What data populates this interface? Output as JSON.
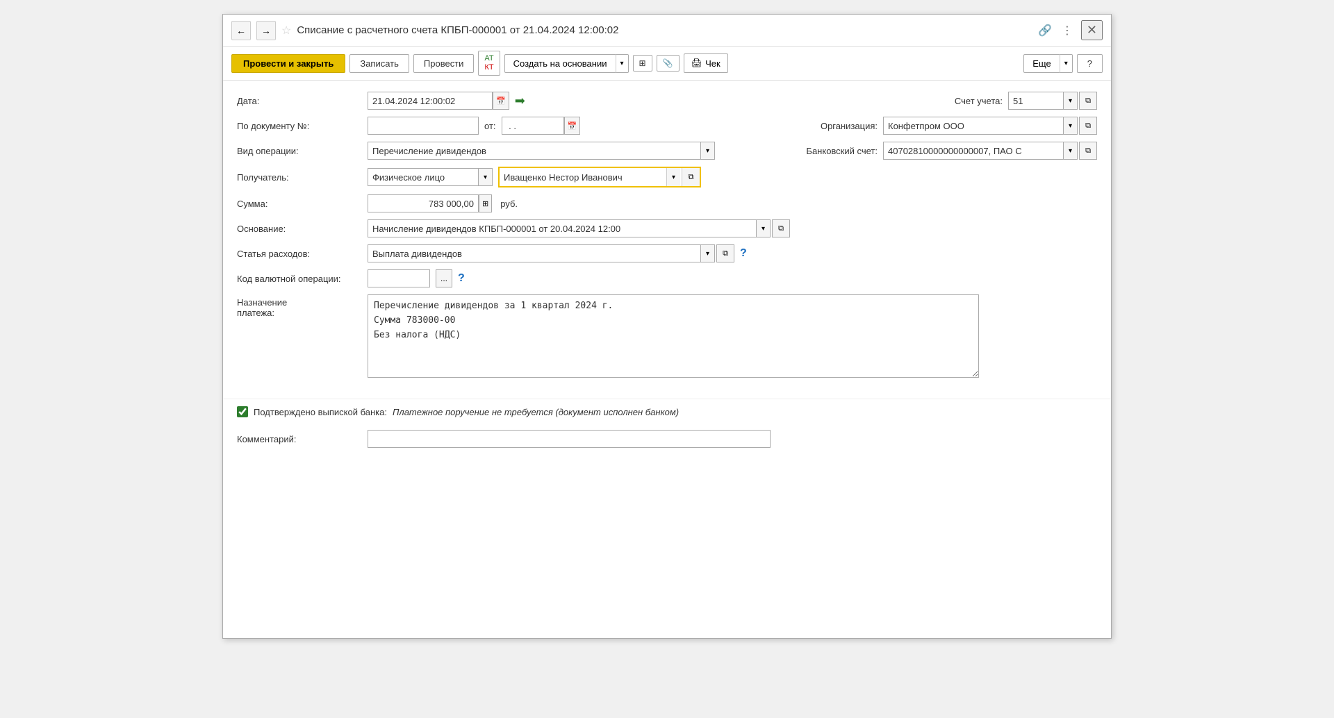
{
  "window": {
    "title": "Списание с расчетного счета КПБП-000001 от 21.04.2024 12:00:02"
  },
  "toolbar": {
    "btn_post_close": "Провести и закрыть",
    "btn_save": "Записать",
    "btn_post": "Провести",
    "btn_atkt_top": "АТ",
    "btn_atkt_bot": "КТ",
    "btn_create_based": "Создать на основании",
    "btn_cheque": "Чек",
    "btn_more": "Еще",
    "btn_help": "?"
  },
  "form": {
    "date_label": "Дата:",
    "date_value": "21.04.2024 12:00:02",
    "account_label": "Счет учета:",
    "account_value": "51",
    "doc_number_label": "По документу №:",
    "doc_number_from": "от:",
    "doc_date_value": " . .",
    "org_label": "Организация:",
    "org_value": "Конфетпром ООО",
    "op_type_label": "Вид операции:",
    "op_type_value": "Перечисление дивидендов",
    "bank_account_label": "Банковский счет:",
    "bank_account_value": "40702810000000000007, ПАО С",
    "recipient_label": "Получатель:",
    "recipient_type": "Физическое лицо",
    "recipient_name": "Иващенко Нестор Иванович",
    "amount_label": "Сумма:",
    "amount_value": "783 000,00",
    "amount_currency": "руб.",
    "basis_label": "Основание:",
    "basis_value": "Начисление дивидендов КПБП-000001 от 20.04.2024 12:00",
    "expense_label": "Статья расходов:",
    "expense_value": "Выплата дивидендов",
    "currency_code_label": "Код валютной операции:",
    "currency_code_value": "",
    "payment_purpose_label": "Назначение платежа:",
    "payment_purpose_value": "Перечисление дивидендов за 1 квартал 2024 г.\nСумма 783000-00\nБез налога (НДС)",
    "confirm_label": "Подтверждено выпиской банка:",
    "confirm_value": "Платежное поручение не требуется (документ исполнен банком)",
    "comment_label": "Комментарий:",
    "comment_value": ""
  },
  "icons": {
    "back": "←",
    "forward": "→",
    "star": "☆",
    "link": "🔗",
    "menu": "⋮",
    "close": "✕",
    "calendar": "📅",
    "green_arrow": "➡",
    "dropdown": "▾",
    "copy": "⧉",
    "calculator": "⊞",
    "question": "?",
    "ellipsis": "...",
    "cheque_icon": "🖨",
    "copy_small": "⧉"
  }
}
